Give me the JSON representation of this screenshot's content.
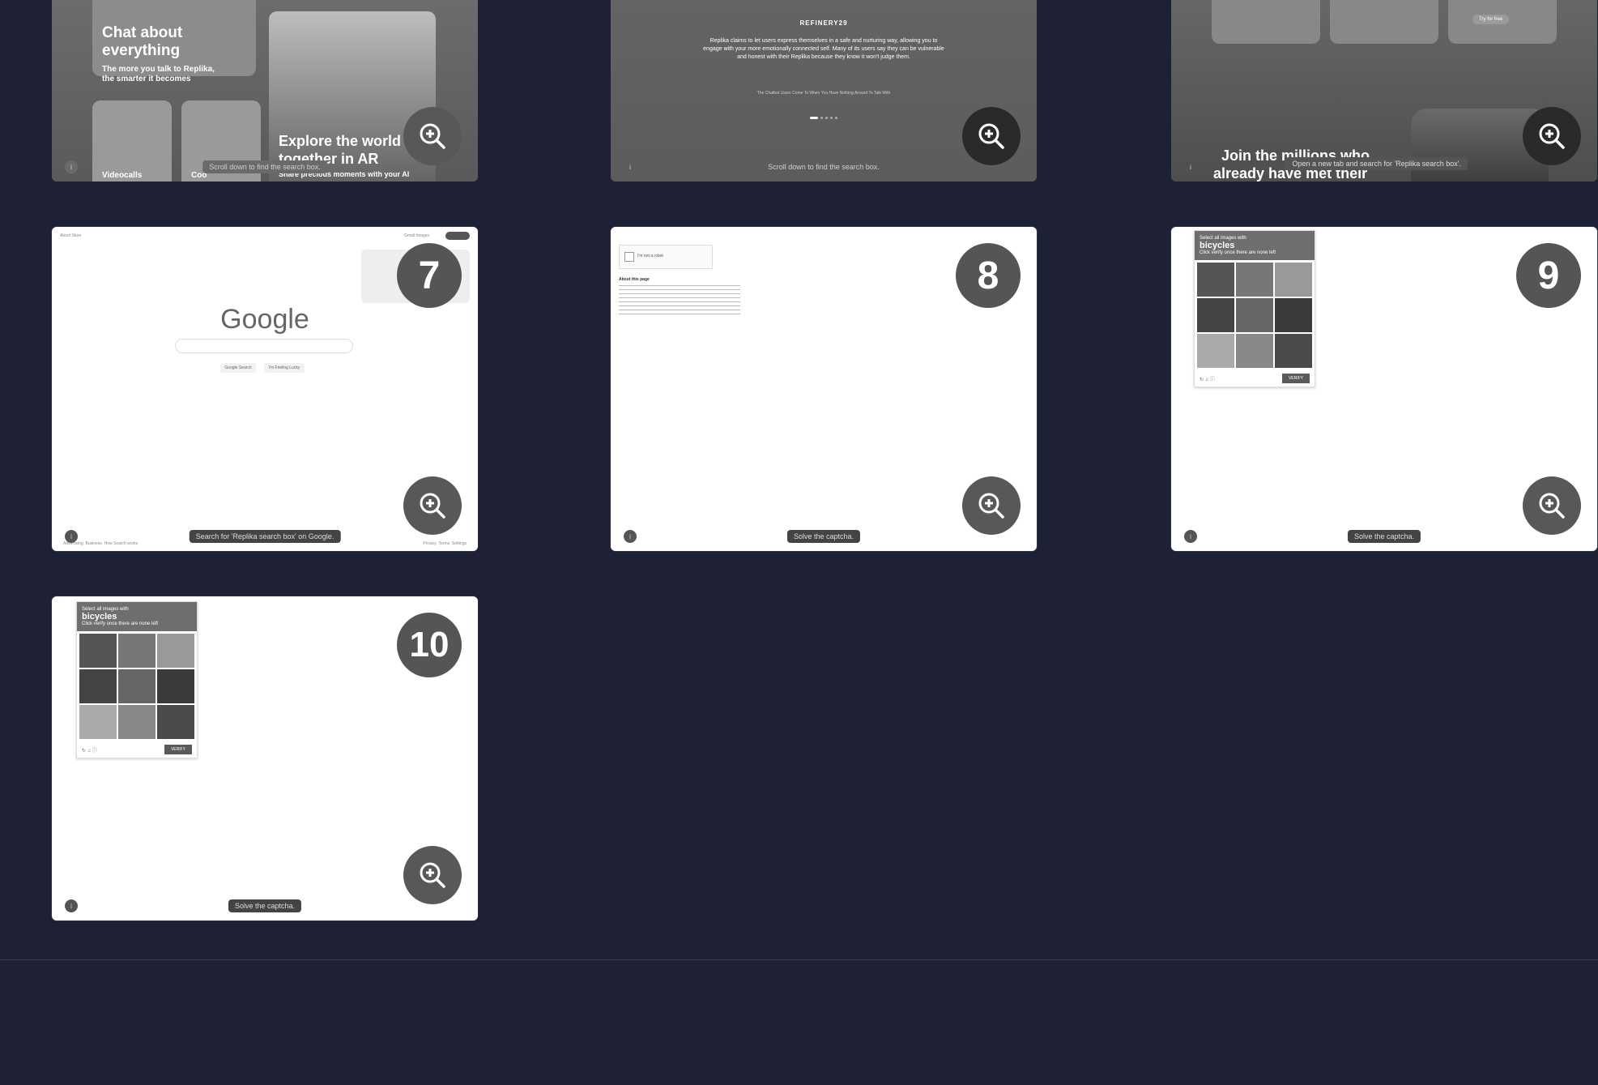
{
  "cards": {
    "c1": {
      "title_lines": [
        "Chat about",
        "everything"
      ],
      "sub_lines": [
        "The more you talk to Replika,",
        "the smarter it becomes"
      ],
      "tile1_label": "Videocalls",
      "tile2_label": "Coo",
      "ar_lines": [
        "Explore the world",
        "together in AR"
      ],
      "ar_sub": "Share precious moments with your AI",
      "caption": "Scroll down to find the search box."
    },
    "c2": {
      "brand": "REFINERY29",
      "quote": "Replika claims to let users express themselves in a safe and nurturing way, allowing you to engage with your more emotionally connected self. Many of its users say they can be vulnerable and honest with their Replika because they know it won't judge them.",
      "byline": "The Chatbot Users Come To When You Have Nothing Around To Talk With",
      "caption": "Scroll down to find the search box."
    },
    "c3": {
      "join_lines": [
        "Join the millions who",
        "already have met their"
      ],
      "btn": "Try for free",
      "caption": "Open a new tab and search for 'Replika search box'."
    },
    "c7": {
      "number": "7",
      "logo": "Google",
      "btn1": "Google Search",
      "btn2": "I'm Feeling Lucky",
      "footer_left": [
        "Advertising",
        "Business",
        "How Search works"
      ],
      "footer_right": [
        "Privacy",
        "Terms",
        "Settings"
      ],
      "caption": "Search for 'Replika search box' on Google."
    },
    "c8": {
      "number": "8",
      "checkbox_label": "I'm not a robot",
      "about": "About this page",
      "caption": "Solve the captcha."
    },
    "c9": {
      "number": "9",
      "select_text": "Select all images with",
      "target": "bicycles",
      "hint": "Click verify once there are none left",
      "verify": "VERIFY",
      "caption": "Solve the captcha."
    },
    "c10": {
      "number": "10",
      "select_text": "Select all images with",
      "target": "bicycles",
      "hint": "Click verify once there are none left",
      "verify": "VERIFY",
      "caption": "Solve the captcha."
    }
  },
  "icons": {
    "zoom": "zoom-in-icon"
  }
}
